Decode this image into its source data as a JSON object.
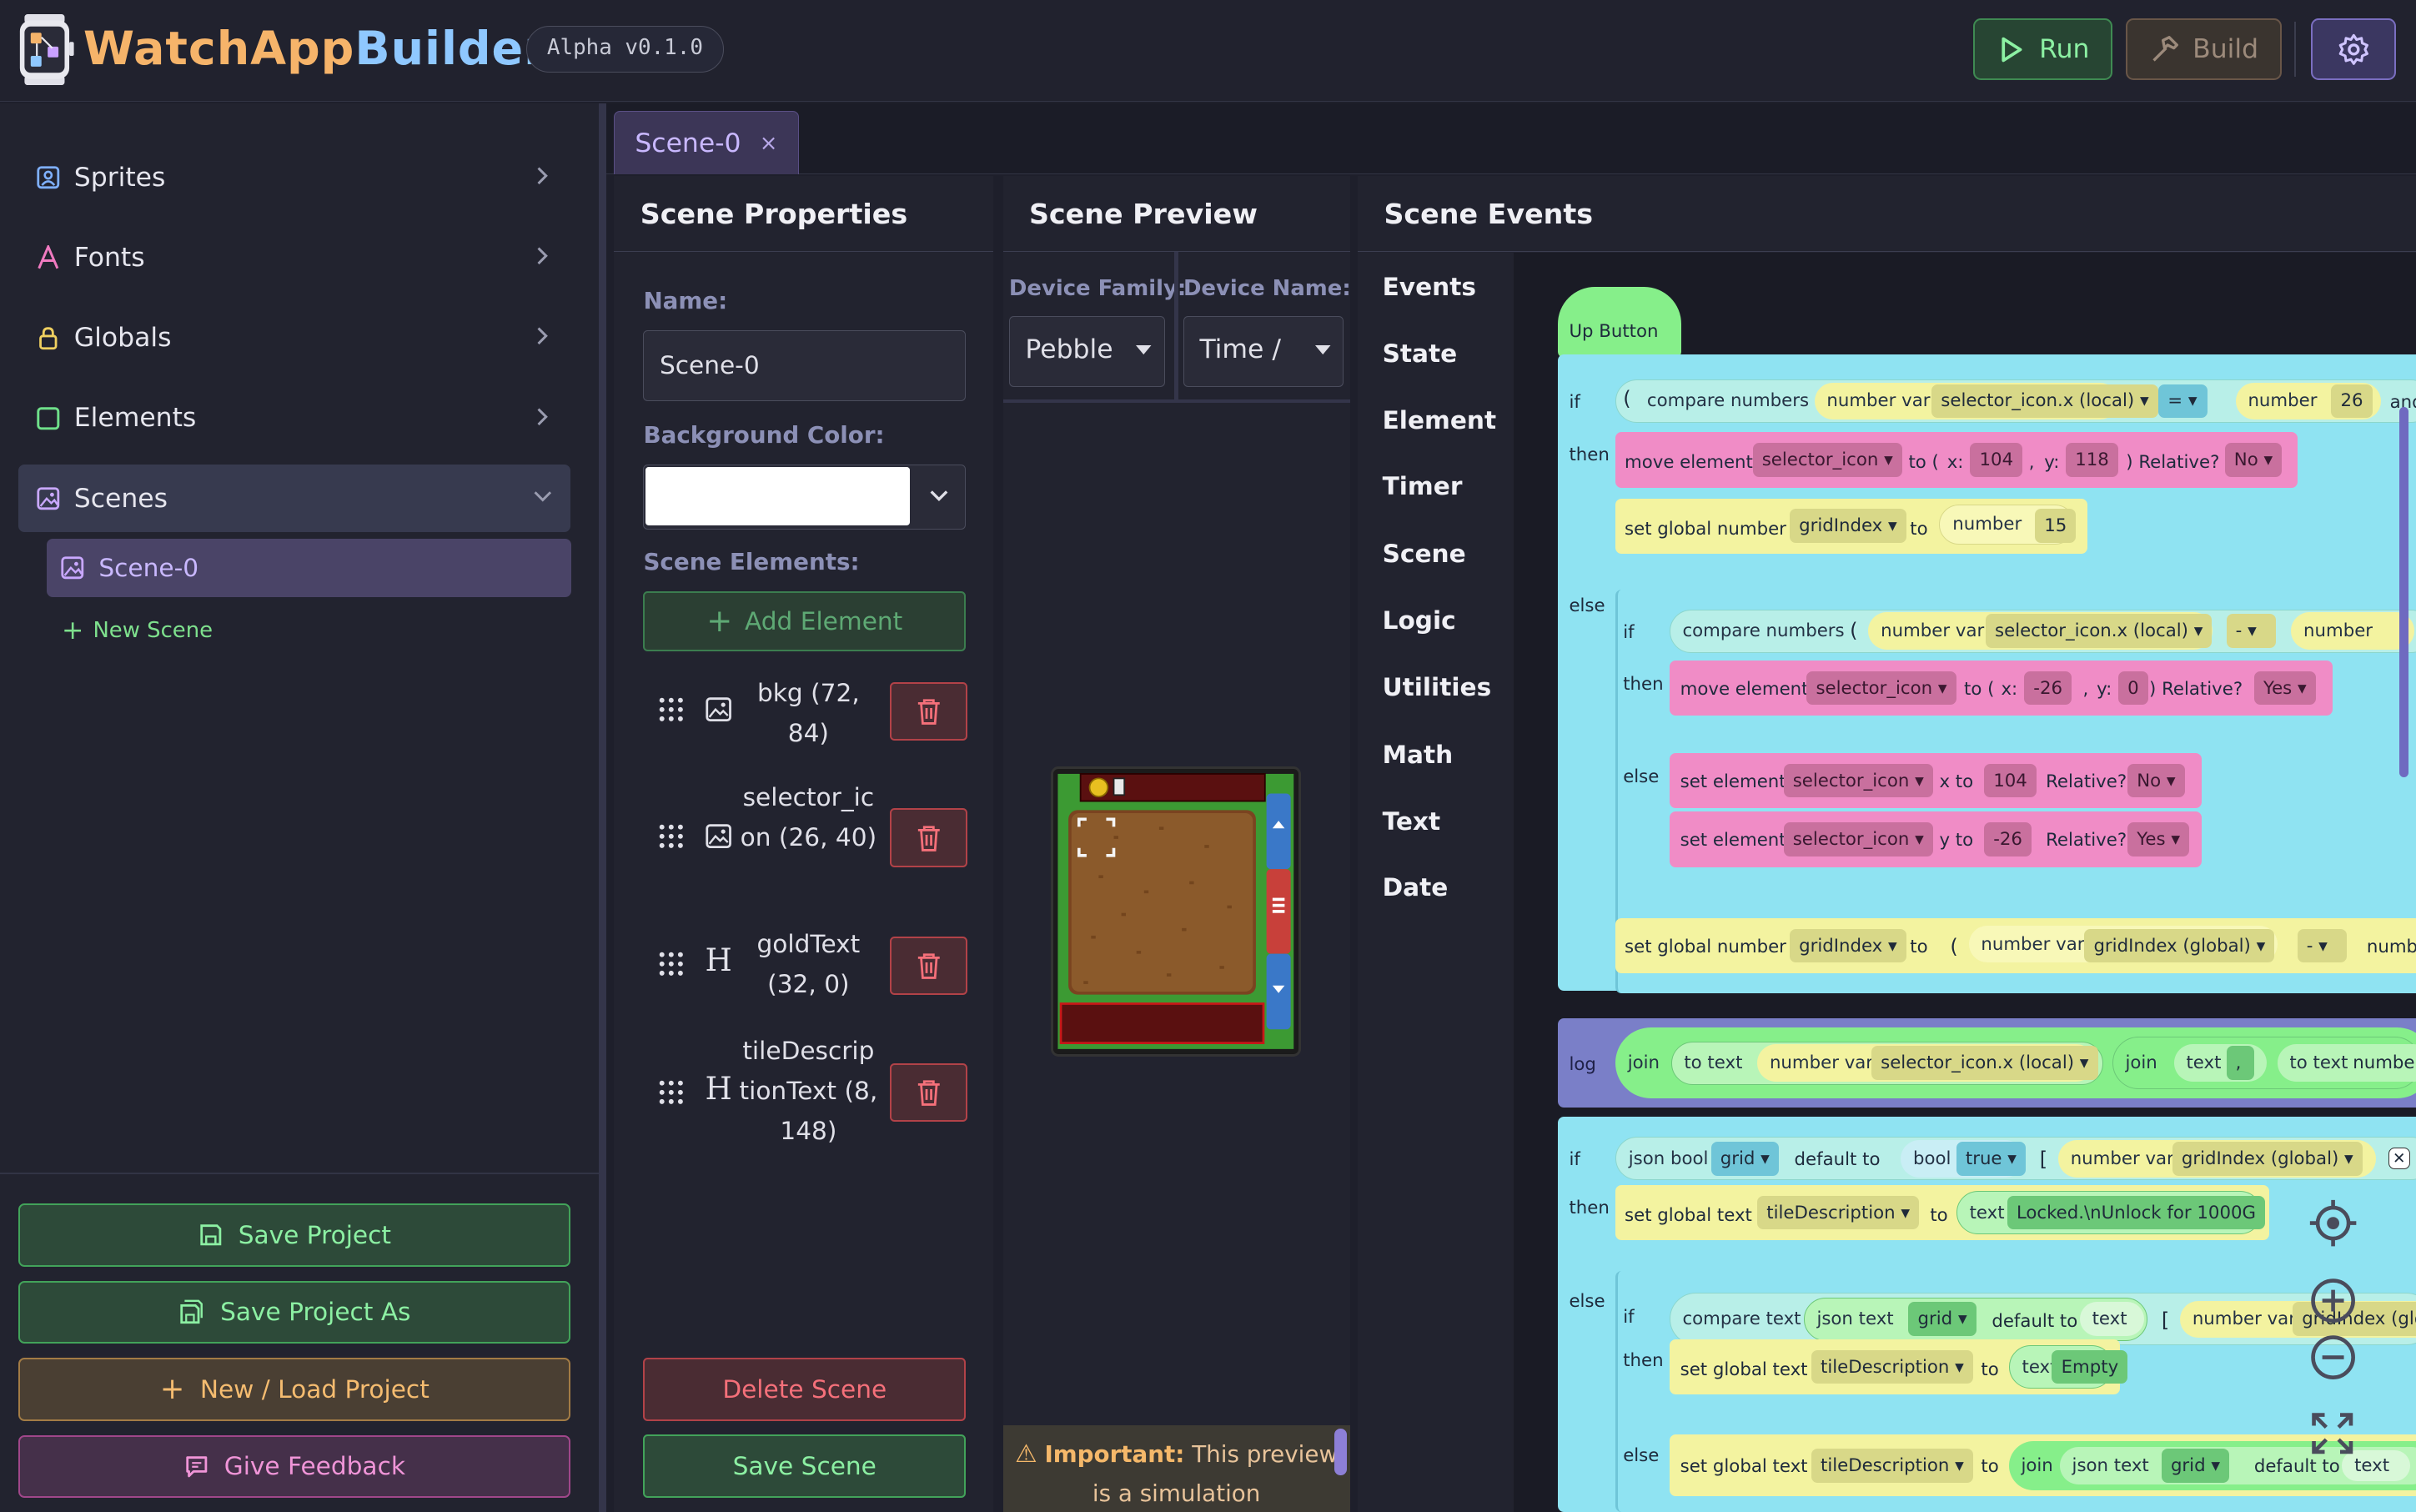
{
  "header": {
    "title_a": "Watch",
    "title_b": "App",
    "title_c": "Builder",
    "version": "Alpha v0.1.0",
    "run_label": "Run",
    "build_label": "Build"
  },
  "sidebar": {
    "items": [
      {
        "label": "Sprites"
      },
      {
        "label": "Fonts"
      },
      {
        "label": "Globals"
      },
      {
        "label": "Elements"
      },
      {
        "label": "Scenes"
      }
    ],
    "scene_item": "Scene-0",
    "new_scene": "New Scene",
    "footer": {
      "save": "Save Project",
      "save_as": "Save Project As",
      "new_load": "New / Load Project",
      "feedback": "Give Feedback"
    }
  },
  "tab": {
    "label": "Scene-0",
    "close": "×"
  },
  "props": {
    "title": "Scene Properties",
    "name_label": "Name:",
    "name_value": "Scene-0",
    "bg_label": "Background Color:",
    "bg_color": "#ffffff",
    "elements_label": "Scene Elements:",
    "add_element": "Add Element",
    "elements": [
      {
        "name": "bkg (72, 84)",
        "kind": "image"
      },
      {
        "name": "selector_icon (26, 40)",
        "kind": "image"
      },
      {
        "name": "goldText (32, 0)",
        "kind": "text"
      },
      {
        "name": "tileDescriptionText (8, 148)",
        "kind": "text"
      }
    ],
    "delete_scene": "Delete Scene",
    "save_scene": "Save Scene"
  },
  "preview": {
    "title": "Scene Preview",
    "family_label": "Device Family:",
    "family_value": "Pebble",
    "name_label": "Device Name:",
    "name_value": "Time / ",
    "important_bold": "Important:",
    "important_rest": " This preview is a simulation"
  },
  "events": {
    "title": "Scene Events",
    "categories": [
      "Events",
      "State",
      "Element",
      "Timer",
      "Scene",
      "Logic",
      "Utilities",
      "Math",
      "Text",
      "Date"
    ],
    "blocks": {
      "hat": "Up Button",
      "if": "if",
      "then": "then",
      "else": "else",
      "log": "log",
      "compare_numbers": "compare numbers",
      "compare_text": "compare text",
      "number_var": "number var",
      "selector_x_local": "selector_icon.x (local)",
      "eq": "=",
      "minus": "-",
      "number": "number",
      "n26": "26",
      "n104": "104",
      "n118": "118",
      "n15": "15",
      "nm26": "-26",
      "n0": "0",
      "move_element": "move element",
      "selector_icon": "selector_icon",
      "to_paren": "to (",
      "x_colon": "x:",
      "y_colon": "y:",
      "comma": ",",
      "rel": ") Relative?",
      "relative_q": "Relative?",
      "no": "No",
      "yes": "Yes",
      "set_global_number": "set global number",
      "gridIndex": "gridIndex",
      "to": "to",
      "set_element": "set element",
      "x_to": "x to",
      "y_to": "y to",
      "gridIndex_global": "gridIndex (global)",
      "join": "join",
      "to_text": "to text",
      "text": "text",
      "json_bool": "json bool",
      "grid": "grid",
      "default_to": "default to",
      "bool": "bool",
      "true": "true",
      "lbracket": "[",
      "close_bracket": "].",
      "set_global_text": "set global text",
      "tileDescription": "tileDescription",
      "locked": "Locked.\\nUnlock for 1000G",
      "json_text": "json text",
      "empty": "Empty",
      "and": "and",
      "number_cut": "numb",
      "gridIndex_glo": "gridIndex (glo"
    }
  }
}
